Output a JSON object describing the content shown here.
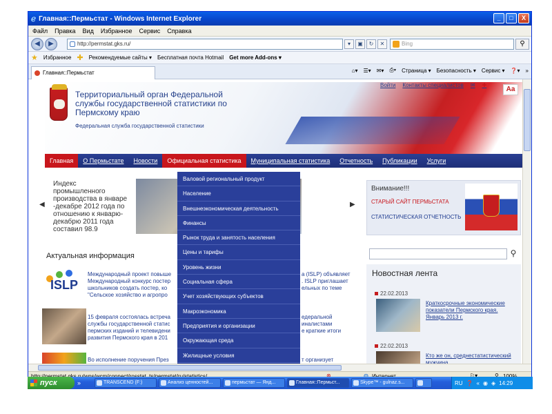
{
  "window": {
    "title": "Главная::Пермьстат - Windows Internet Explorer",
    "min": "_",
    "max": "□",
    "close": "X"
  },
  "menubar": [
    "Файл",
    "Правка",
    "Вид",
    "Избранное",
    "Сервис",
    "Справка"
  ],
  "address": {
    "url": "http://permstat.gks.ru/",
    "search_placeholder": "Bing"
  },
  "favbar": {
    "favorites": "Избранное",
    "recommended": "Рекомендуемые сайты ▾",
    "hotmail": "Бесплатная почта Hotmail",
    "addons": "Get more Add-ons ▾"
  },
  "tab": {
    "label": "Главная::Пермьстат"
  },
  "cmdbar": {
    "page": "Страница ▾",
    "security": "Безопасность ▾",
    "service": "Сервис ▾",
    "help": "❓▾",
    "more": "»"
  },
  "site": {
    "org_title": "Территориальный орган Федеральной службы государственной статистики по Пермскому краю",
    "org_sub": "Федеральная служба государственной статистики",
    "toplinks": [
      "Войти",
      "Контакты специалистов"
    ],
    "aa": "Aa",
    "nav": [
      "Главная",
      "О Пермьстате",
      "Новости",
      "Официальная статистика",
      "Муниципальная статистика",
      "Отчетность",
      "Публикации",
      "Услуги"
    ],
    "news_index": "Индекс промышленного производства в январе -декабре 2012 года по отношению к январю-декабрю 2011 года составил 98.9",
    "actual_heading": "Актуальная информация",
    "news_rows": [
      "Международный проект повыше",
      "Международный конкурс постер",
      "школьников создать постер, ко",
      "\"Сельское хозяйство и агропро",
      "15 февраля состоялась встреча",
      "службы государственной статис",
      "пермских изданий и телевидени",
      "развития Пермского края в 201",
      "Во исполнение поручения През"
    ],
    "news_rows_right": [
      "а (ISLP) объявляет",
      ". ISLP приглашает",
      "ельных по теме",
      "едеральной",
      "иналистами",
      "е краткие итоги",
      "т организует"
    ],
    "islp": "ISLP",
    "dropdown": [
      "Валовой региональный продукт",
      "Население",
      "Внешнеэкономическая деятельность",
      "Финансы",
      "Рынок труда и занятость населения",
      "Цены и тарифы",
      "Уровень жизни",
      "Социальная сфера",
      "Учет хозяйствующих субъектов",
      "Макроэкономика",
      "Предприятия и организации",
      "Окружающая среда",
      "Жилищные условия"
    ],
    "attention": {
      "title": "Внимание!!!",
      "old_site": "СТАРЫЙ САЙТ ПЕРМЬСТАТА",
      "reporting": "СТАТИСТИЧЕСКАЯ ОТЧЕТНОСТЬ"
    },
    "feed": {
      "title": "Новостная лента",
      "items": [
        {
          "date": "22.02.2013",
          "text": "Краткосрочные экономические показатели Пермского края. Январь 2013 г."
        },
        {
          "date": "22.02.2013",
          "text": "Кто же он, среднестатистический мужчина"
        }
      ]
    }
  },
  "statusbar": {
    "url": "http://permstat.gks.ru/wps/wcm/connect/rosstat_ts/permstat/ru/statistics/",
    "zone": "Интернет",
    "zoom": "100%"
  },
  "taskbar": {
    "start": "пуск",
    "tasks": [
      "TRANSCEND (F:)",
      "Анализ ценностей...",
      "пермьстат — Янд...",
      "Главная::Пермьст...",
      "Skype™ - gulnaz.s...",
      ""
    ],
    "lang": "RU",
    "time": "14:29"
  },
  "colors": {
    "nav_bg": "#1e2f78",
    "nav_active": "#c8161c",
    "dropdown_bg": "#2a3f9a",
    "title_blue": "#233f8a",
    "attention_red": "#c8161c"
  }
}
